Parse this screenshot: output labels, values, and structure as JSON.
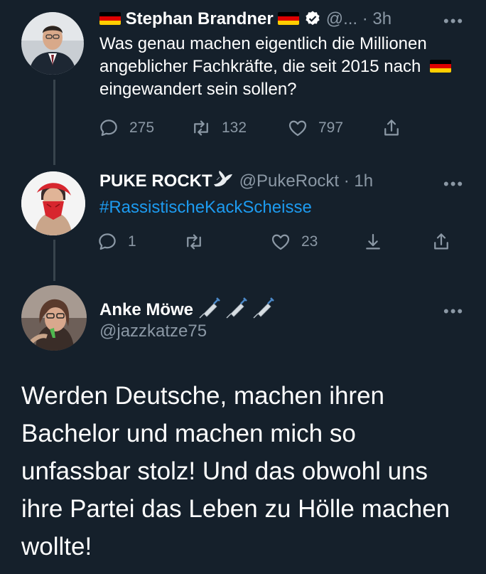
{
  "colors": {
    "background": "#15202b",
    "text": "#ffffff",
    "muted": "#8b98a5",
    "link": "#1d9bf0",
    "line": "#38444d"
  },
  "tweets": [
    {
      "author": "Stephan Brandner",
      "handle": "@...",
      "time": "· 3h",
      "text_before_flag": "Was genau machen eigentlich die Millionen angeblicher Fachkräfte, die seit 2015 nach",
      "text_after_flag": "eingewandert sein sollen?",
      "replies": "275",
      "retweets": "132",
      "likes": "797",
      "more": "•••",
      "icons": [
        "flag-de-icon",
        "verified-badge-icon",
        "reply-icon",
        "retweet-icon",
        "like-icon",
        "share-icon",
        "more-icon"
      ]
    },
    {
      "author": "PUKE ROCKT",
      "handle": "@PukeRockt",
      "time": "· 1h",
      "text": "#RassistischeKackScheisse",
      "replies": "1",
      "likes": "23",
      "more": "•••",
      "icons": [
        "dove-icon",
        "reply-icon",
        "retweet-icon",
        "like-icon",
        "download-icon",
        "share-icon",
        "more-icon"
      ]
    },
    {
      "author": "Anke Möwe",
      "handle": "@jazzkatze75",
      "text": "Werden Deutsche, machen ihren Bachelor und machen mich so unfassbar stolz! Und das obwohl uns ihre Partei das Leben zu Hölle machen wollte!",
      "more": "•••",
      "icons": [
        "syringe-icon",
        "more-icon"
      ]
    }
  ]
}
